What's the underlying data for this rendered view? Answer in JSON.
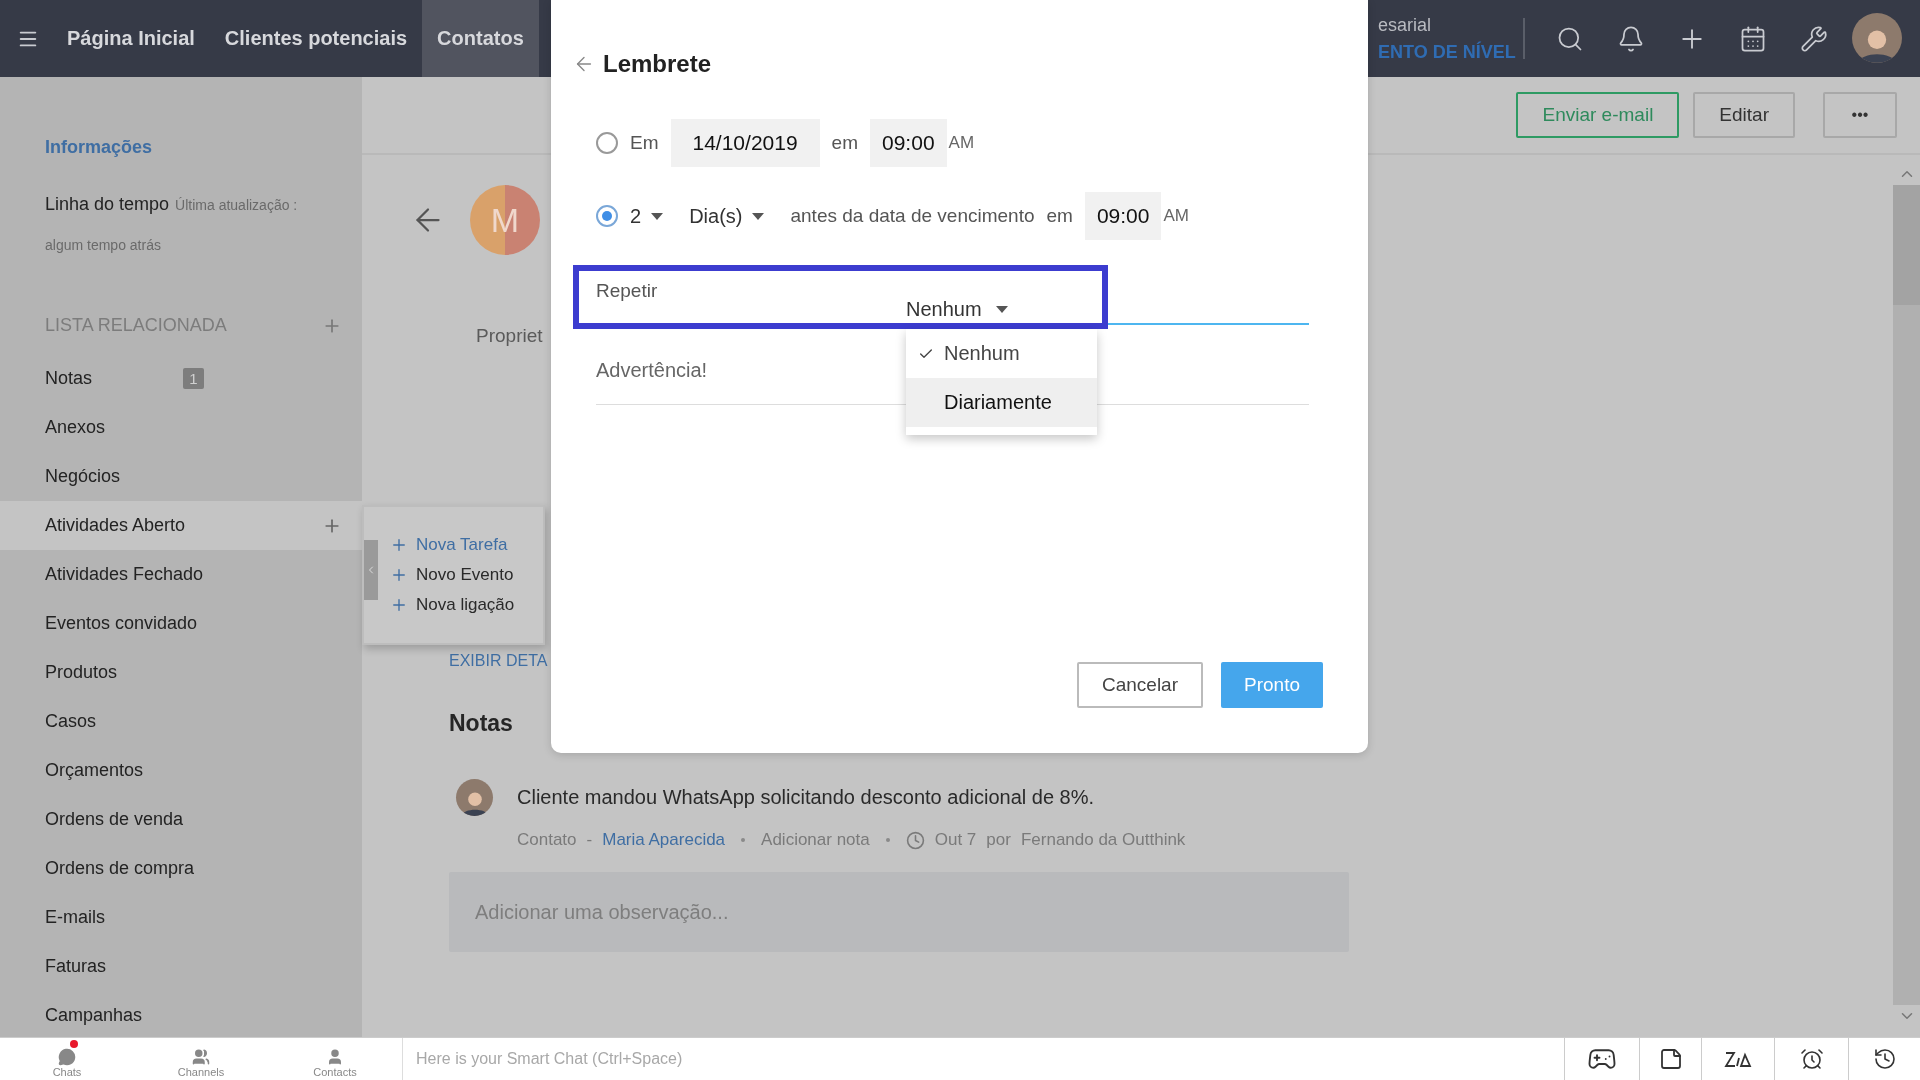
{
  "top_nav": {
    "tabs": [
      {
        "label": "Página Inicial",
        "selected": false
      },
      {
        "label": "Clientes potenciais",
        "selected": false
      },
      {
        "label": "Contatos",
        "selected": true
      }
    ],
    "edition_label": "esarial",
    "upgrade_link": "ENTO DE NÍVEL"
  },
  "sidebar": {
    "info_link": "Informações",
    "timeline": {
      "label": "Linha do tempo",
      "updated": "Última atualização :",
      "ago": "algum tempo atrás"
    },
    "related_title": "LISTA RELACIONADA",
    "items": [
      {
        "label": "Notas",
        "count": "1",
        "selected": false
      },
      {
        "label": "Anexos",
        "selected": false
      },
      {
        "label": "Negócios",
        "selected": false
      },
      {
        "label": "Atividades Aberto",
        "selected": true
      },
      {
        "label": "Atividades Fechado",
        "selected": false
      },
      {
        "label": "Eventos convidado",
        "selected": false
      },
      {
        "label": "Produtos",
        "selected": false
      },
      {
        "label": "Casos",
        "selected": false
      },
      {
        "label": "Orçamentos",
        "selected": false
      },
      {
        "label": "Ordens de venda",
        "selected": false
      },
      {
        "label": "Ordens de compra",
        "selected": false
      },
      {
        "label": "E-mails",
        "selected": false
      },
      {
        "label": "Faturas",
        "selected": false
      },
      {
        "label": "Campanhas",
        "selected": false
      }
    ]
  },
  "quick_add_menu": [
    {
      "label": "Nova Tarefa",
      "selected": true
    },
    {
      "label": "Novo Evento",
      "selected": false
    },
    {
      "label": "Nova ligação",
      "selected": false
    }
  ],
  "record": {
    "buttons": [
      {
        "label": "Enviar e-mail",
        "kind": "outline"
      },
      {
        "label": "Editar",
        "kind": "plain"
      },
      {
        "label": "•••",
        "kind": "more"
      }
    ],
    "avatar_letter": "M",
    "owner_label": "Propriet",
    "details_link": "EXIBIR DETA",
    "notes_title": "Notas",
    "note": {
      "text": "Cliente mandou WhatsApp solicitando desconto adicional de 8%.",
      "module": "Contato",
      "separator": "-",
      "contact": "Maria Aparecida",
      "add_note": "Adicionar nota",
      "date": "Out 7",
      "by": "por",
      "author": "Fernando da Outthink"
    },
    "note_input": {
      "placeholder": "Adicionar uma observação..."
    }
  },
  "reminder_dialog": {
    "title": "Lembrete",
    "options": [
      {
        "kind": "date",
        "selected": false,
        "prefix": "Em",
        "date": "14/10/2019",
        "at": "em",
        "time": "09:00",
        "meridiem": "AM"
      },
      {
        "kind": "before",
        "selected": true,
        "count": "2",
        "unit": "Dia(s)",
        "text": "antes da data de vencimento",
        "at": "em",
        "time": "09:00",
        "meridiem": "AM"
      }
    ],
    "repeat": {
      "label": "Repetir",
      "value": "Nenhum",
      "highlighted": true,
      "options": [
        {
          "label": "Nenhum",
          "selected": true,
          "hovered": false
        },
        {
          "label": "Diariamente",
          "selected": false,
          "hovered": true
        }
      ]
    },
    "warning": {
      "placeholder": "Advertência!"
    },
    "buttons": [
      {
        "label": "Cancelar",
        "kind": "secondary"
      },
      {
        "label": "Pronto",
        "kind": "primary"
      }
    ]
  },
  "bottom_bar": {
    "apps": [
      {
        "label": "Chats",
        "kind": "chats",
        "unread": true
      },
      {
        "label": "Channels",
        "kind": "channels",
        "unread": false
      },
      {
        "label": "Contacts",
        "kind": "contacts",
        "unread": false
      }
    ],
    "smart_chat": {
      "placeholder": "Here is your Smart Chat (Ctrl+Space)"
    }
  }
}
